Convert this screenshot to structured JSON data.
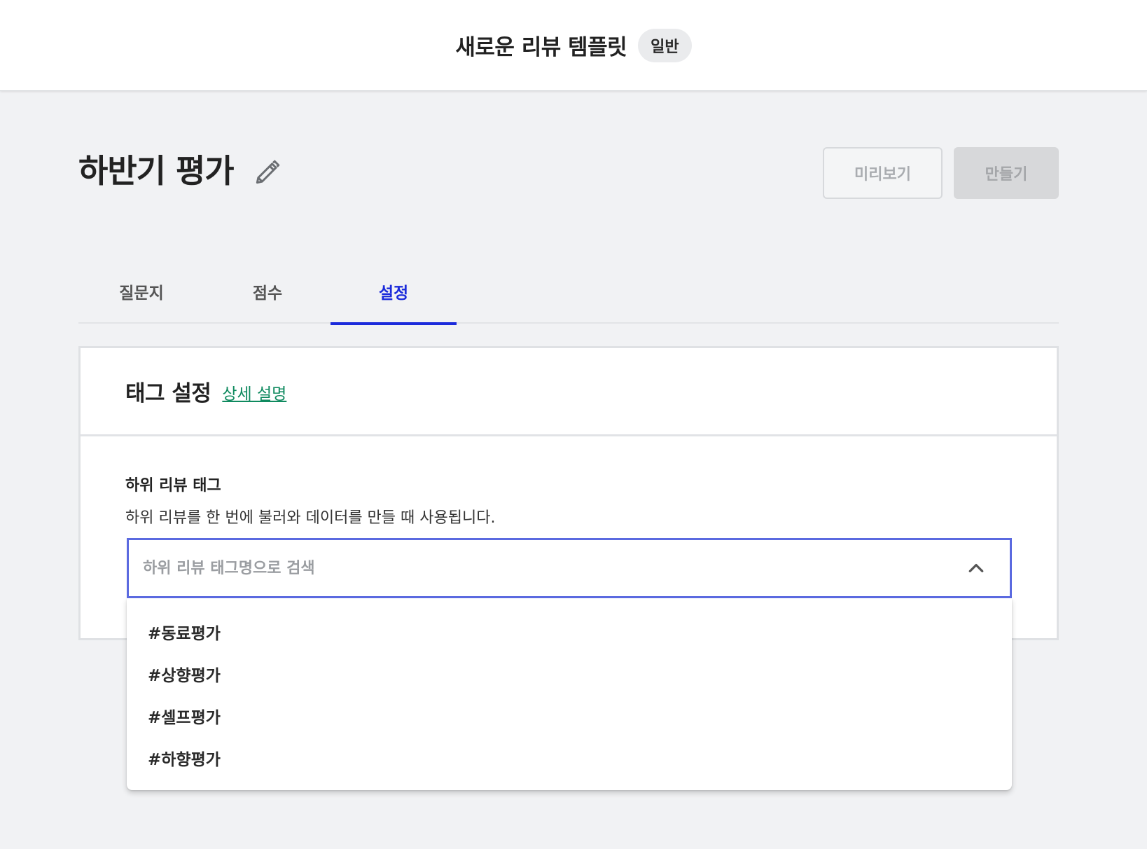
{
  "header": {
    "title": "새로운 리뷰 템플릿",
    "badge": "일반"
  },
  "page": {
    "title": "하반기 평가",
    "edit_icon": "pencil-icon",
    "buttons": {
      "preview": "미리보기",
      "create": "만들기"
    }
  },
  "tabs": [
    {
      "label": "질문지",
      "active": false
    },
    {
      "label": "점수",
      "active": false
    },
    {
      "label": "설정",
      "active": true
    }
  ],
  "section": {
    "title": "태그 설정",
    "help_link": "상세 설명",
    "field": {
      "label": "하위 리뷰 태그",
      "description": "하위 리뷰를 한 번에 불러와 데이터를 만들 때 사용됩니다.",
      "placeholder": "하위 리뷰 태그명으로 검색",
      "value": "",
      "toggle_icon": "chevron-up-icon"
    },
    "options": [
      "#동료평가",
      "#상향평가",
      "#셀프평가",
      "#하향평가"
    ]
  },
  "colors": {
    "accent": "#1b2bdb",
    "focus_border": "#5b6ae0",
    "link": "#0f8a5f",
    "background": "#f1f2f4"
  }
}
